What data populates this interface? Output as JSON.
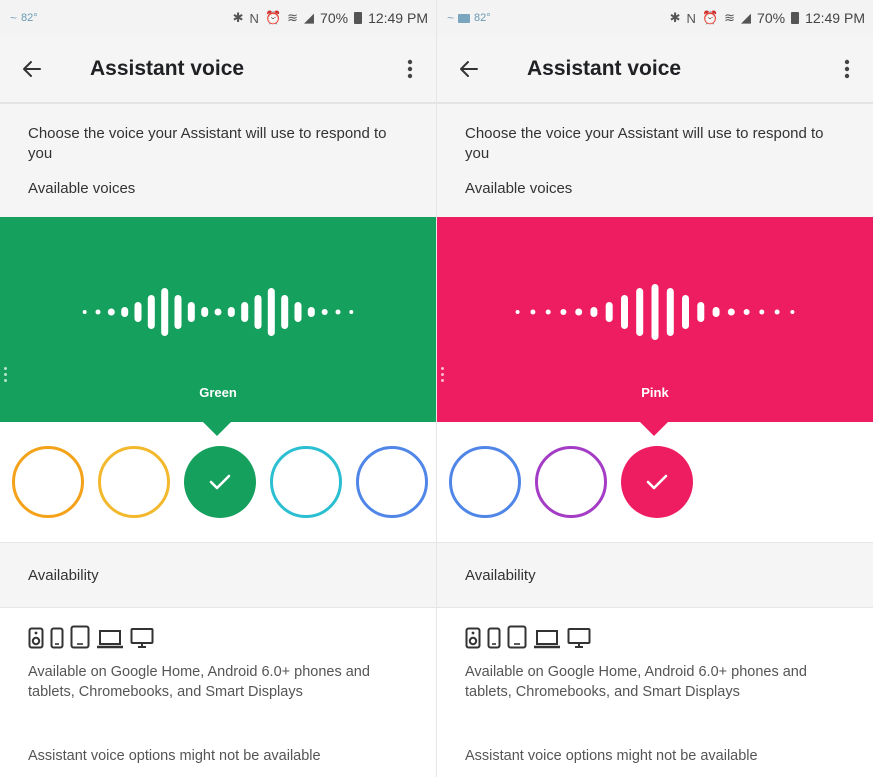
{
  "screens": [
    {
      "status": {
        "temp": "82°",
        "battery": "70%",
        "time": "12:49 PM"
      },
      "title": "Assistant voice",
      "description": "Choose the voice your Assistant will use to respond to you",
      "available_label": "Available voices",
      "selected_voice": {
        "name": "Green",
        "color": "#16a05d"
      },
      "swatches": [
        {
          "color": "#f4a21a",
          "selected": false
        },
        {
          "color": "#f3b82d",
          "selected": false
        },
        {
          "color": "#16a05d",
          "selected": true
        },
        {
          "color": "#2bbfd1",
          "selected": false
        },
        {
          "color": "#4f86e8",
          "selected": false
        }
      ],
      "availability_label": "Availability",
      "availability_text": "Available on Google Home, Android 6.0+ phones and tablets, Chromebooks, and Smart Displays",
      "note_text": "Assistant voice options might not be available"
    },
    {
      "status": {
        "temp": "82°",
        "battery": "70%",
        "time": "12:49 PM"
      },
      "title": "Assistant voice",
      "description": "Choose the voice your Assistant will use to respond to you",
      "available_label": "Available voices",
      "selected_voice": {
        "name": "Pink",
        "color": "#ee1d62"
      },
      "swatches": [
        {
          "color": "#4f86e8",
          "selected": false
        },
        {
          "color": "#a43cc6",
          "selected": false
        },
        {
          "color": "#ee1d62",
          "selected": true
        }
      ],
      "availability_label": "Availability",
      "availability_text": "Available on Google Home, Android 6.0+ phones and tablets, Chromebooks, and Smart Displays",
      "note_text": "Assistant voice options might not be available"
    }
  ],
  "icons": {
    "back": "arrow-left-icon",
    "more": "more-vert-icon",
    "check": "check-icon",
    "devices": [
      "speaker-icon",
      "phone-icon",
      "tablet-icon",
      "laptop-icon",
      "display-icon"
    ]
  }
}
